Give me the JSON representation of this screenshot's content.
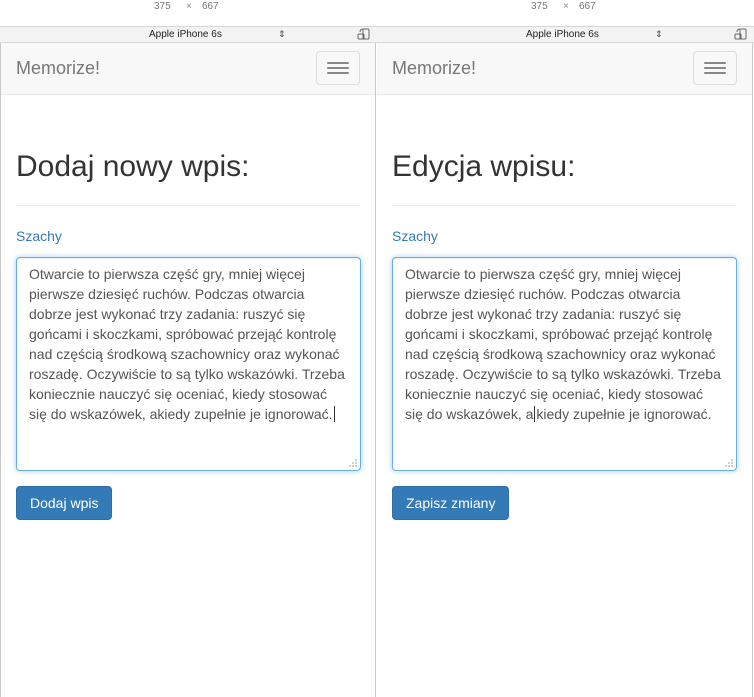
{
  "panels": [
    {
      "viewport": {
        "width": "375",
        "times": "×",
        "height": "667"
      },
      "device_name": "Apple iPhone 6s",
      "device_select_arrows": "⇕",
      "rotate_icon": "rotate-device-icon",
      "navbar": {
        "brand": "Memorize!",
        "toggle_icon": "hamburger-menu-icon"
      },
      "heading": "Dodaj nowy wpis:",
      "category_label": "Szachy",
      "textarea_lines": [
        "Otwarcie to pierwsza część gry, mniej więcej",
        "pierwsze dziesięć ruchów. Podczas otwarcia",
        "dobrze jest wykonać trzy zadania: ruszyć się",
        "gońcami i skoczkami, spróbować przejąć kontrolę",
        "nad częścią środkową szachownicy oraz wykonać",
        "roszadę. Oczywiście to są tylko wskazówki. Trzeba",
        "koniecznie nauczyć się oceniać, kiedy stosować",
        "się do wskazówek, akiedy zupełnie je ignorować."
      ],
      "button_label": "Dodaj wpis"
    },
    {
      "viewport": {
        "width": "375",
        "times": "×",
        "height": "667"
      },
      "device_name": "Apple iPhone 6s",
      "device_select_arrows": "⇕",
      "rotate_icon": "rotate-device-icon",
      "navbar": {
        "brand": "Memorize!",
        "toggle_icon": "hamburger-menu-icon"
      },
      "heading": "Edycja wpisu:",
      "category_label": "Szachy",
      "textarea_lines": [
        "Otwarcie to pierwsza część gry, mniej więcej",
        "pierwsze dziesięć ruchów. Podczas otwarcia",
        "dobrze jest wykonać trzy zadania: ruszyć się",
        "gońcami i skoczkami, spróbować przejąć kontrolę",
        "nad częścią środkową szachownicy oraz wykonać",
        "roszadę. Oczywiście to są tylko wskazówki. Trzeba",
        "koniecznie nauczyć się oceniać, kiedy stosować"
      ],
      "textarea_last_line_before_caret": "się do wskazówek, a",
      "textarea_last_line_after_caret": "kiedy zupełnie je ignorować.",
      "button_label": "Zapisz zmiany"
    }
  ],
  "colors": {
    "accent": "#337ab7",
    "focus_border": "#66afe9",
    "navbar_bg": "#f8f8f8"
  }
}
